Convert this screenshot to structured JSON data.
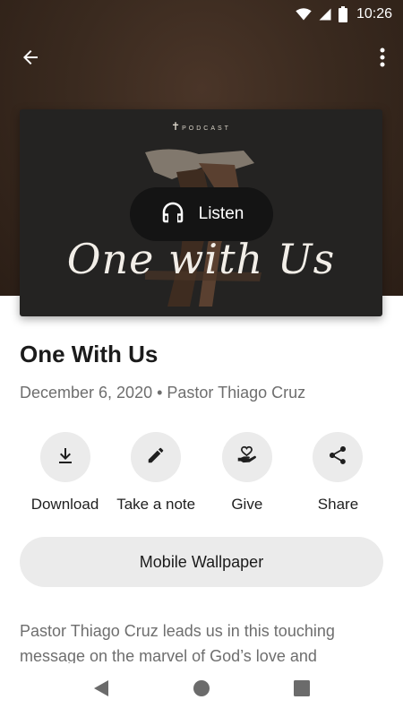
{
  "status_bar": {
    "time": "10:26",
    "icons": [
      "wifi-icon",
      "cell-signal-icon",
      "battery-icon"
    ]
  },
  "app_bar": {
    "back_icon": "arrow-back-icon",
    "more_icon": "more-vert-icon"
  },
  "artwork": {
    "brand": "PODCAST",
    "title": "One with Us",
    "listen_label": "Listen",
    "listen_icon": "headphones-icon"
  },
  "episode": {
    "title": "One With Us",
    "meta": "December 6, 2020 • Pastor Thiago Cruz"
  },
  "actions": [
    {
      "label": "Download",
      "icon": "download-icon"
    },
    {
      "label": "Take a note",
      "icon": "pencil-icon"
    },
    {
      "label": "Give",
      "icon": "give-heart-hand-icon"
    },
    {
      "label": "Share",
      "icon": "share-icon"
    }
  ],
  "wallpaper_button": "Mobile Wallpaper",
  "description": "Pastor Thiago Cruz leads us in this touching message on the marvel of God’s love and",
  "colors": {
    "hero_bg": "#3a2a1f",
    "artwork_bg": "#242322",
    "listen_bg": "#141414",
    "chip_bg": "#ebebeb",
    "secondary_text": "#6e6e6e"
  }
}
